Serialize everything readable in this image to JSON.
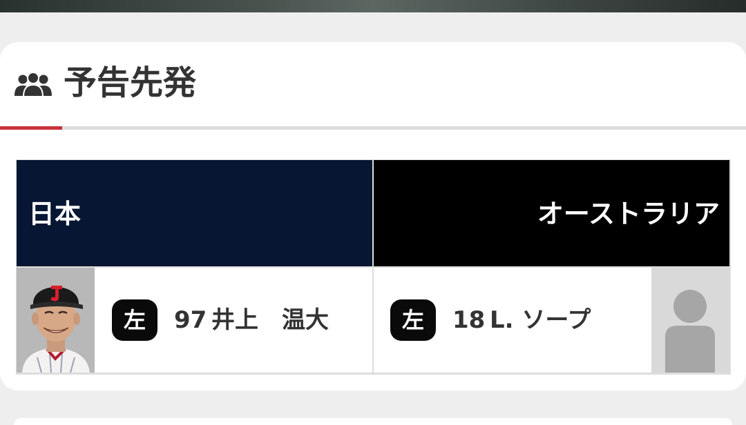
{
  "section": {
    "title": "予告先発",
    "icon": "people-icon",
    "accent_color": "#c8323c"
  },
  "teams": [
    {
      "name": "日本",
      "band_color": "#061633",
      "pitcher": {
        "hand": "左",
        "number": "97",
        "name": "井上　温大",
        "photo": "player-photo"
      }
    },
    {
      "name": "オーストラリア",
      "band_color": "#000000",
      "pitcher": {
        "hand": "左",
        "number": "18",
        "name": "L. ソープ",
        "photo": "avatar-placeholder-icon"
      }
    }
  ]
}
